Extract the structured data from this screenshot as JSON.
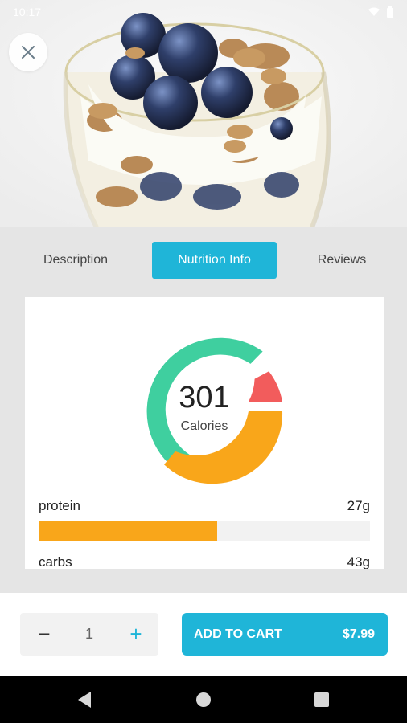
{
  "status_bar": {
    "time": "10:17"
  },
  "tabs": [
    {
      "label": "Description",
      "active": false
    },
    {
      "label": "Nutrition Info",
      "active": true
    },
    {
      "label": "Reviews",
      "active": false
    }
  ],
  "nutrition": {
    "calories_value": "301",
    "calories_label": "Calories",
    "items": [
      {
        "name": "protein",
        "amount": "27g",
        "fraction": 0.54,
        "color": "#f9a61a"
      },
      {
        "name": "carbs",
        "amount": "43g",
        "fraction": 0.0,
        "color": "#f9a61a"
      }
    ],
    "donut_segments": [
      {
        "label": "green",
        "color": "#3fcf9f",
        "fraction": 0.5
      },
      {
        "label": "red",
        "color": "#f25c5c",
        "fraction": 0.083
      },
      {
        "label": "orange",
        "color": "#f9a61a",
        "fraction": 0.33
      }
    ]
  },
  "cart": {
    "quantity": "1",
    "minus_label": "−",
    "plus_label": "+",
    "add_label": "ADD TO CART",
    "price": "$7.99"
  },
  "colors": {
    "accent": "#1fb5d8",
    "protein": "#f9a61a",
    "donut_green": "#3fcf9f",
    "donut_red": "#f25c5c",
    "donut_orange": "#f9a61a"
  },
  "icons": {
    "close": "close-icon",
    "back": "back-icon",
    "home": "home-icon",
    "recents": "recents-icon"
  }
}
